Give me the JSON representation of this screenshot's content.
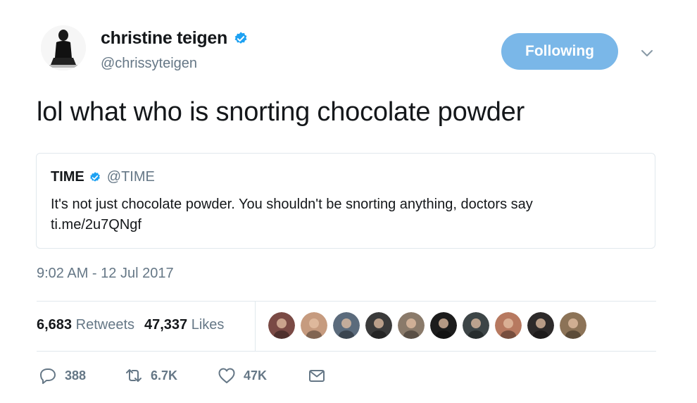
{
  "author": {
    "name": "christine teigen",
    "handle": "@chrissyteigen",
    "verified_icon": "verified-badge-icon",
    "avatar_icon": "profile-avatar"
  },
  "follow_button": {
    "label": "Following"
  },
  "menu": {
    "icon": "chevron-down-icon"
  },
  "tweet": {
    "text": "lol what who is snorting chocolate powder",
    "timestamp": "9:02 AM - 12 Jul 2017"
  },
  "quoted_tweet": {
    "name": "TIME",
    "handle": "@TIME",
    "text": "It's not just chocolate powder. You shouldn't be snorting anything, doctors say",
    "link": "ti.me/2u7QNgf"
  },
  "stats": {
    "retweets_count": "6,683",
    "retweets_label": "Retweets",
    "likes_count": "47,337",
    "likes_label": "Likes"
  },
  "facepile": [
    {
      "name": "liker-avatar-1",
      "color": "#7a4a45"
    },
    {
      "name": "liker-avatar-2",
      "color": "#c69b7f"
    },
    {
      "name": "liker-avatar-3",
      "color": "#5b6b7c"
    },
    {
      "name": "liker-avatar-4",
      "color": "#3a3a3a"
    },
    {
      "name": "liker-avatar-5",
      "color": "#8a7a6a"
    },
    {
      "name": "liker-avatar-6",
      "color": "#1c1c1c"
    },
    {
      "name": "liker-avatar-7",
      "color": "#3d4547"
    },
    {
      "name": "liker-avatar-8",
      "color": "#b77960"
    },
    {
      "name": "liker-avatar-9",
      "color": "#2d2a2a"
    },
    {
      "name": "liker-avatar-10",
      "color": "#8c7357"
    }
  ],
  "actions": {
    "reply_count": "388",
    "retweet_count": "6.7K",
    "like_count": "47K"
  },
  "colors": {
    "accent": "#1da1f2",
    "follow_button_bg": "#7ab7e8",
    "muted_text": "#657786",
    "border": "#e1e8ed"
  }
}
